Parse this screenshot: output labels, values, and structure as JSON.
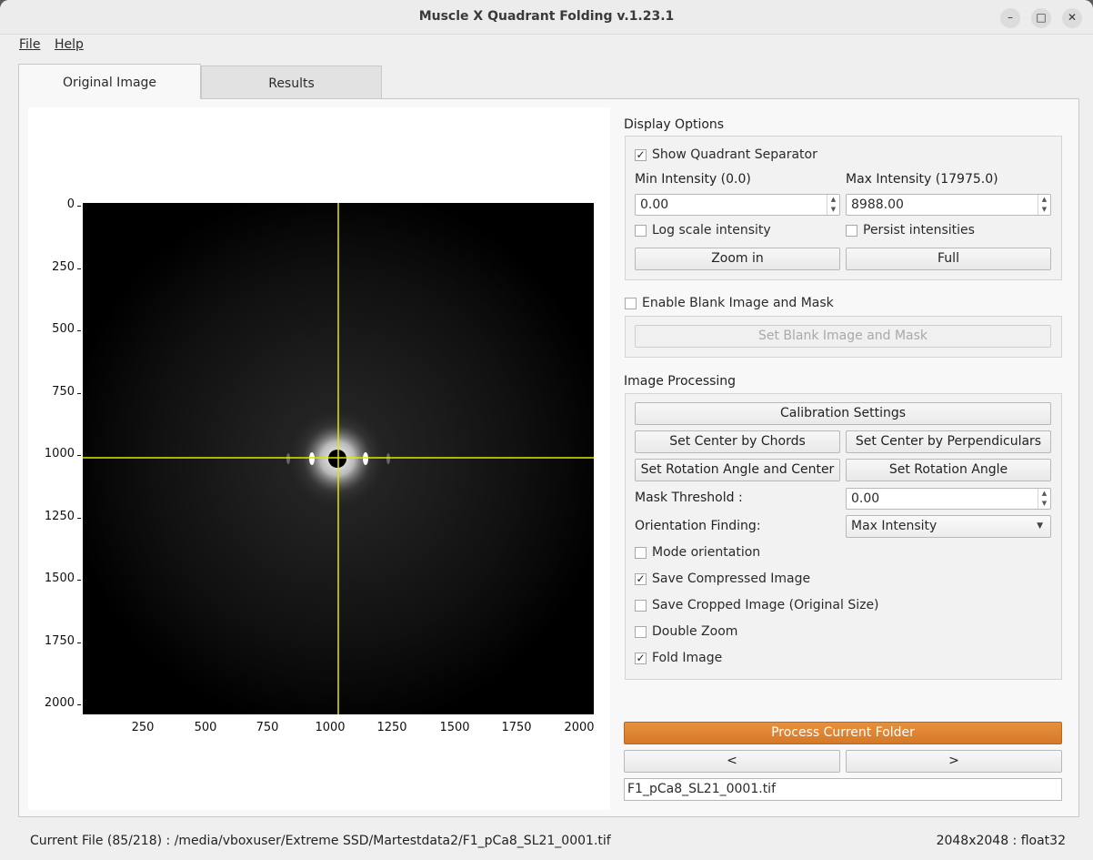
{
  "window": {
    "title": "Muscle X Quadrant Folding v.1.23.1",
    "minimize_icon": "minimize-icon",
    "maximize_icon": "maximize-icon",
    "close_icon": "close-icon"
  },
  "menu": {
    "file": "File",
    "help": "Help"
  },
  "tabs": [
    {
      "label": "Original Image",
      "active": true
    },
    {
      "label": "Results",
      "active": false
    }
  ],
  "plot": {
    "y_ticks": [
      "0",
      "250",
      "500",
      "750",
      "1000",
      "1250",
      "1500",
      "1750",
      "2000"
    ],
    "x_ticks": [
      "250",
      "500",
      "750",
      "1000",
      "1250",
      "1500",
      "1750",
      "2000"
    ],
    "separator_color": "#e6e600"
  },
  "display_options": {
    "title": "Display Options",
    "show_quadrant_separator": {
      "label": "Show Quadrant Separator",
      "checked": true
    },
    "min_intensity_label": "Min Intensity (0.0)",
    "max_intensity_label": "Max Intensity (17975.0)",
    "min_intensity_value": "0.00",
    "max_intensity_value": "8988.00",
    "log_scale": {
      "label": "Log scale intensity",
      "checked": false
    },
    "persist": {
      "label": "Persist intensities",
      "checked": false
    },
    "zoom_in": "Zoom in",
    "full": "Full"
  },
  "blank": {
    "enable": {
      "label": "Enable Blank Image and Mask",
      "checked": false
    },
    "set_button": "Set Blank Image and Mask"
  },
  "processing": {
    "title": "Image Processing",
    "calibration": "Calibration Settings",
    "center_chords": "Set Center by Chords",
    "center_perp": "Set Center by Perpendiculars",
    "rot_angle_center": "Set Rotation Angle and Center",
    "rot_angle": "Set Rotation Angle",
    "mask_threshold_label": "Mask Threshold :",
    "mask_threshold_value": "0.00",
    "orientation_label": "Orientation Finding:",
    "orientation_value": "Max Intensity",
    "mode_orientation": {
      "label": "Mode orientation",
      "checked": false
    },
    "save_compressed": {
      "label": "Save Compressed Image",
      "checked": true
    },
    "save_cropped": {
      "label": "Save Cropped Image (Original Size)",
      "checked": false
    },
    "double_zoom": {
      "label": "Double Zoom",
      "checked": false
    },
    "fold_image": {
      "label": "Fold Image",
      "checked": true
    }
  },
  "actions": {
    "process_folder": "Process Current Folder",
    "prev": "<",
    "next": ">",
    "filename": "F1_pCa8_SL21_0001.tif"
  },
  "status": {
    "current_file": "Current File (85/218) : /media/vboxuser/Extreme SSD/Martestdata2/F1_pCa8_SL21_0001.tif",
    "dimensions": "2048x2048 : float32"
  },
  "check_mark": "✓"
}
